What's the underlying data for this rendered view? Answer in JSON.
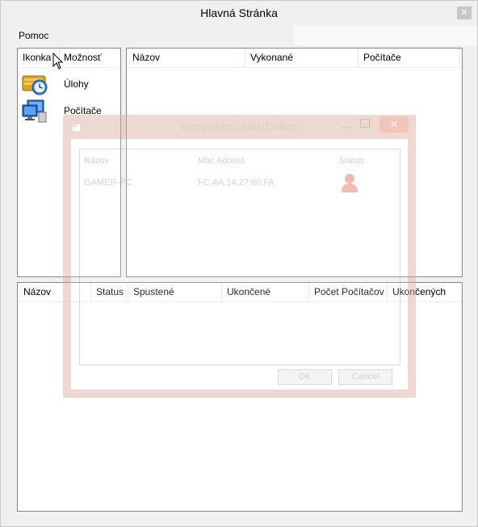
{
  "window": {
    "title": "Hlavná Stránka",
    "close_glyph": "✕"
  },
  "menu": {
    "items": [
      {
        "label": "Pomoc"
      }
    ]
  },
  "options_panel": {
    "headers": [
      "Ikonka",
      "Možnosť"
    ],
    "items": [
      {
        "label": "Úlohy",
        "icon": "tasks-clock-icon"
      },
      {
        "label": "Počítače",
        "icon": "computers-icon"
      }
    ]
  },
  "tasks_panel": {
    "headers": [
      "Názov",
      "Vykonané",
      "Počítače"
    ]
  },
  "bottom_panel": {
    "headers": [
      "Názov",
      "Status",
      "Spustené",
      "Ukončené",
      "Počet Počítačov",
      "Ukončených"
    ]
  },
  "dialog": {
    "title": "computersSelectDialog",
    "headers": [
      "Názov",
      "Mac Adresa",
      "Status"
    ],
    "rows": [
      {
        "name": "GAMER-PC",
        "mac": "FC:AA:14:27:60:FA",
        "status_icon": "user-icon"
      }
    ],
    "ok_label": "OK",
    "cancel_label": "Cancel",
    "min_glyph": "—",
    "close_glyph": "✕"
  }
}
